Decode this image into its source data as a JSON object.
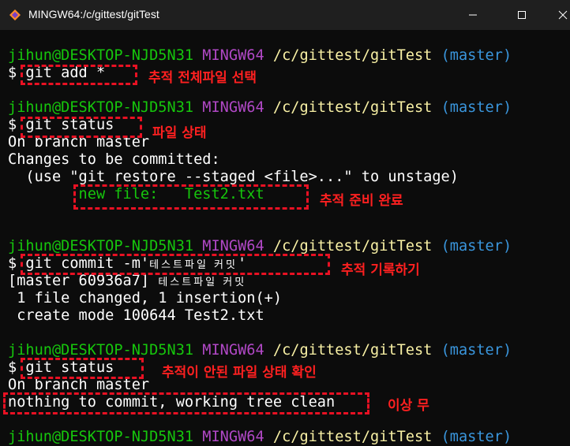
{
  "window": {
    "title": "MINGW64:/c/gittest/gitTest"
  },
  "prompt": {
    "user": "jihun@DESKTOP-NJD5N31",
    "env": "MINGW64",
    "path": "/c/gittest/gitTest",
    "branch": "(master)"
  },
  "lines": {
    "cmd1": "$ git add *",
    "cmd2": "$ git status",
    "out2_1": "On branch master",
    "out2_2": "Changes to be committed:",
    "out2_3": "  (use \"git restore --staged <file>...\" to unstage)",
    "out2_4": "        new file:   Test2.txt",
    "cmd3_prefix": "$ git commit -m'",
    "cmd3_ko": "테스트파일 커밋",
    "cmd3_suffix": "'",
    "out3_1_prefix": "[master 60936a7] ",
    "out3_1_ko": "테스트파일 커밋",
    "out3_2": " 1 file changed, 1 insertion(+)",
    "out3_3": " create mode 100644 Test2.txt",
    "cmd4": "$ git status",
    "out4_1": "On branch master",
    "out4_2": "nothing to commit, working tree clean"
  },
  "annotations": {
    "a1": "추적 전체파일 선택",
    "a2": "파일 상태",
    "a3": "추적 준비 완료",
    "a4": "추적 기록하기",
    "a5": "추적이 안된 파일 상태 확인",
    "a6": "이상 무"
  },
  "colors": {
    "background": "#0c0c0c",
    "green": "#16c60c",
    "magenta": "#b148c6",
    "yellow": "#f9f1a5",
    "cyan": "#3a96dd",
    "annotation": "#e81123"
  }
}
